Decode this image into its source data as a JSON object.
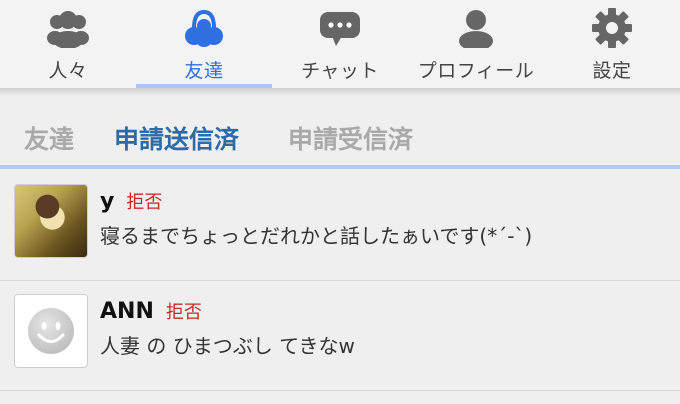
{
  "nav": {
    "items": [
      {
        "label": "人々",
        "icon": "people-icon"
      },
      {
        "label": "友達",
        "icon": "friends-icon"
      },
      {
        "label": "チャット",
        "icon": "chat-bubble-icon"
      },
      {
        "label": "プロフィール",
        "icon": "person-icon"
      },
      {
        "label": "設定",
        "icon": "gear-icon"
      }
    ],
    "active": "友達"
  },
  "subtabs": {
    "items": [
      "友達",
      "申請送信済",
      "申請受信済"
    ],
    "active": "申請送信済"
  },
  "requests": [
    {
      "name": "y",
      "action": "拒否",
      "message": "寝るまでちょっとだれかと話したぁいです(*´-`)"
    },
    {
      "name": "ANN",
      "action": "拒否",
      "message": "人妻 の ひまつぶし てきなw"
    }
  ],
  "colors": {
    "accent_blue": "#2f6fe0",
    "tab_active": "#2d6aa8",
    "tab_inactive": "#a9a9a9",
    "underline": "#b2cde9",
    "reject_red": "#c62a2a"
  }
}
